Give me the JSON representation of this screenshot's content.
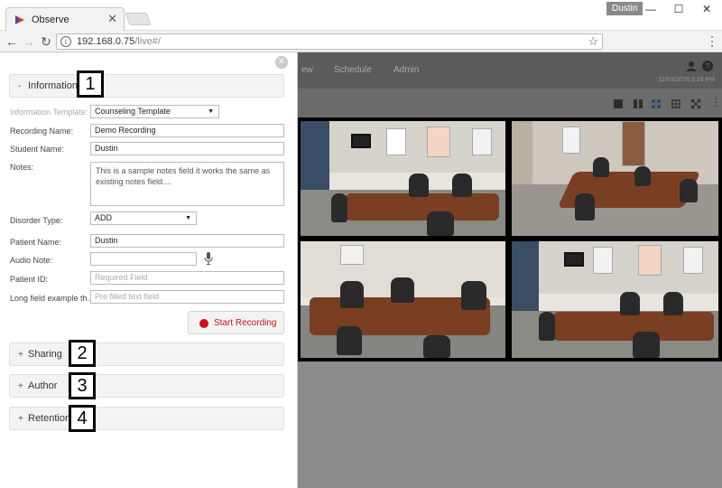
{
  "browser": {
    "tab_title": "Observe",
    "tab_close": "✕",
    "user_badge": "Dustin",
    "url_host": "192.168.0.75",
    "url_path": "/live#/",
    "window_controls": [
      "—",
      "☐",
      "✕"
    ]
  },
  "app": {
    "nav": [
      "ew",
      "Schedule",
      "Admin"
    ],
    "datetime": "11/03/2016 2:16 PM"
  },
  "panel": {
    "close": "✕",
    "sections": {
      "information": {
        "toggle": "-",
        "label": "Information",
        "callout": "1"
      },
      "sharing": {
        "toggle": "+",
        "label": "Sharing",
        "callout": "2"
      },
      "author": {
        "toggle": "+",
        "label": "Author",
        "callout": "3"
      },
      "retention": {
        "toggle": "+",
        "label": "Retention",
        "callout": "4"
      }
    },
    "form": {
      "information_template_label": "Information Template:",
      "information_template_value": "Counseling Template",
      "recording_name_label": "Recording Name:",
      "recording_name_value": "Demo Recording",
      "student_name_label": "Student Name:",
      "student_name_value": "Dustin",
      "notes_label": "Notes:",
      "notes_value": "This is a sample notes field it works the same as existing notes field....",
      "disorder_type_label": "Disorder Type:",
      "disorder_type_value": "ADD",
      "patient_name_label": "Patient Name:",
      "patient_name_value": "Dustin",
      "audio_note_label": "Audio Note:",
      "audio_note_value": "",
      "patient_id_label": "Patient ID:",
      "patient_id_placeholder": "Required Field",
      "long_field_label": "Long field example th...",
      "long_field_placeholder": "Pre filled text field"
    },
    "start_recording_label": "Start Recording"
  },
  "colors": {
    "record_red": "#d0101a",
    "app_overlay": "#6f6f6f",
    "active_layout": "#2e4e74"
  }
}
